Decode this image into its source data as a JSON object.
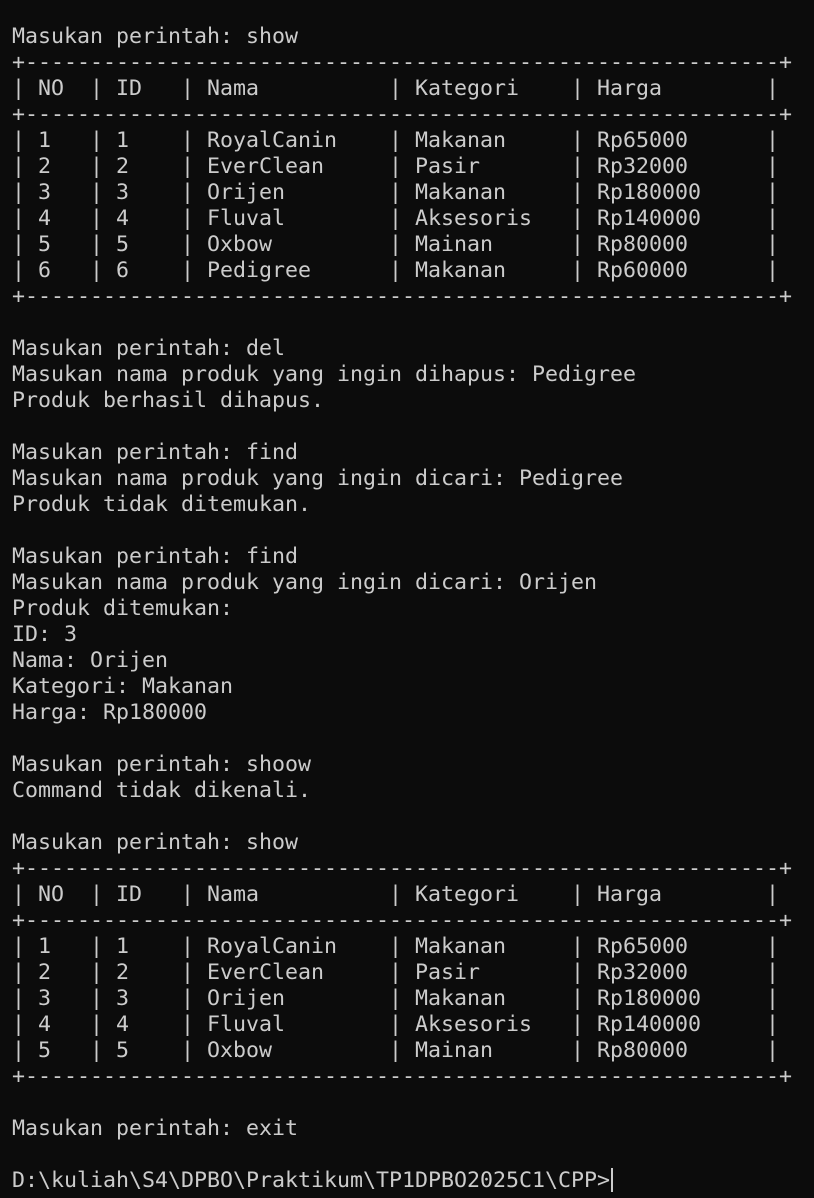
{
  "terminal": {
    "lines": [
      "Masukan perintah: show",
      "+----------------------------------------------------------+",
      "| NO  | ID   | Nama          | Kategori    | Harga        |",
      "+----------------------------------------------------------+",
      "| 1   | 1    | RoyalCanin    | Makanan     | Rp65000      |",
      "| 2   | 2    | EverClean     | Pasir       | Rp32000      |",
      "| 3   | 3    | Orijen        | Makanan     | Rp180000     |",
      "| 4   | 4    | Fluval        | Aksesoris   | Rp140000     |",
      "| 5   | 5    | Oxbow         | Mainan      | Rp80000      |",
      "| 6   | 6    | Pedigree      | Makanan     | Rp60000      |",
      "+----------------------------------------------------------+",
      "",
      "Masukan perintah: del",
      "Masukan nama produk yang ingin dihapus: Pedigree",
      "Produk berhasil dihapus.",
      "",
      "Masukan perintah: find",
      "Masukan nama produk yang ingin dicari: Pedigree",
      "Produk tidak ditemukan.",
      "",
      "Masukan perintah: find",
      "Masukan nama produk yang ingin dicari: Orijen",
      "Produk ditemukan:",
      "ID: 3",
      "Nama: Orijen",
      "Kategori: Makanan",
      "Harga: Rp180000",
      "",
      "Masukan perintah: shoow",
      "Command tidak dikenali.",
      "",
      "Masukan perintah: show",
      "+----------------------------------------------------------+",
      "| NO  | ID   | Nama          | Kategori    | Harga        |",
      "+----------------------------------------------------------+",
      "| 1   | 1    | RoyalCanin    | Makanan     | Rp65000      |",
      "| 2   | 2    | EverClean     | Pasir       | Rp32000      |",
      "| 3   | 3    | Orijen        | Makanan     | Rp180000     |",
      "| 4   | 4    | Fluval        | Aksesoris   | Rp140000     |",
      "| 5   | 5    | Oxbow         | Mainan      | Rp80000      |",
      "+----------------------------------------------------------+",
      "",
      "Masukan perintah: exit",
      ""
    ],
    "prompt": "D:\\kuliah\\S4\\DPBO\\Praktikum\\TP1DPBO2025C1\\CPP>"
  }
}
